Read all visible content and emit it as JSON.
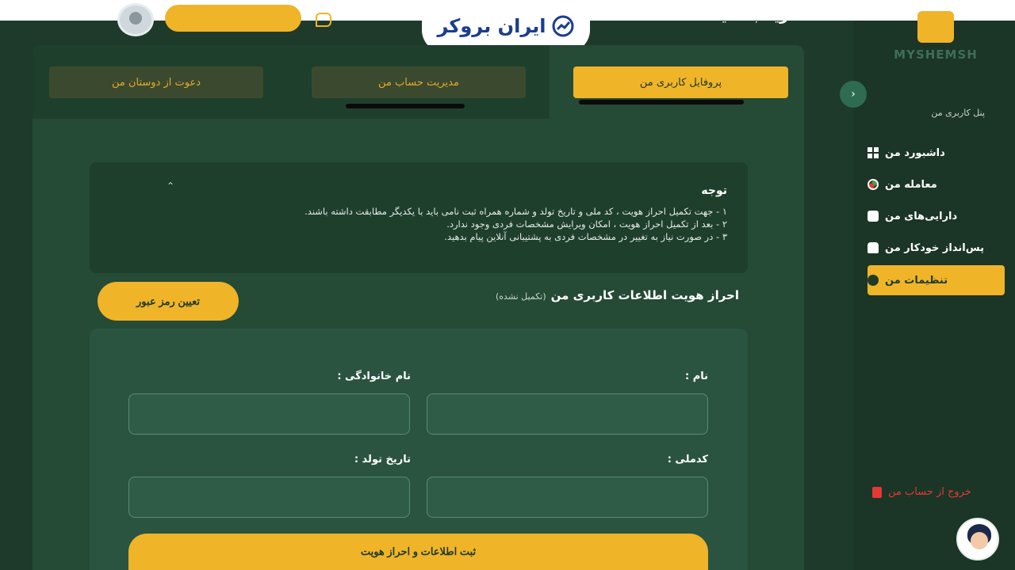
{
  "brand": {
    "watermark": "ایران بروکر",
    "logo_text": "MYSHEMSH"
  },
  "header": {
    "title": "خرید به قیمت ..."
  },
  "sidebar": {
    "panel_label": "پنل کاربری من",
    "items": [
      {
        "label": "داشبورد من",
        "icon": "grid-icon"
      },
      {
        "label": "معامله من",
        "icon": "trade-icon"
      },
      {
        "label": "دارایی‌های من",
        "icon": "wallet-icon"
      },
      {
        "label": "پس‌انداز خودکار من",
        "icon": "robot-icon"
      },
      {
        "label": "تنظیمات من",
        "icon": "gear-icon",
        "active": true
      }
    ],
    "logout": "خروج از حساب من"
  },
  "tabs": [
    {
      "label": "پروفایل کاربری من",
      "active": true
    },
    {
      "label": "مدیریت حساب من",
      "active": false
    },
    {
      "label": "دعوت از دوستان من",
      "active": false
    }
  ],
  "notice": {
    "title": "توجه",
    "lines": [
      "۱ - جهت تکمیل احراز هویت ، کد ملی و تاریخ تولد و شماره همراه ثبت نامی باید با یکدیگر مطابقت داشته باشند.",
      "۲ - بعد از تکمیل احراز هویت ، امکان ویرایش مشخصات فردی وجود ندارد.",
      "۳ - در صورت نیاز به تغییر در مشخصات فردی به پشتیبانی آنلاین پیام بدهید."
    ]
  },
  "verification": {
    "title": "احراز هویت اطلاعات کاربری من",
    "status": "(تکمیل نشده)",
    "set_password_button": "تعیین رمز عبور"
  },
  "form": {
    "first_name_label": "نام :",
    "last_name_label": "نام خانوادگی :",
    "national_code_label": "کدملی :",
    "birth_date_label": "تاریخ تولد :",
    "first_name_value": "",
    "last_name_value": "",
    "national_code_value": "",
    "birth_date_value": "",
    "submit_button": "ثبت اطلاعات و احراز هویت"
  },
  "colors": {
    "accent": "#f0b428",
    "background": "#1e3a2b",
    "panel": "#254a36",
    "logout": "#e53935"
  }
}
